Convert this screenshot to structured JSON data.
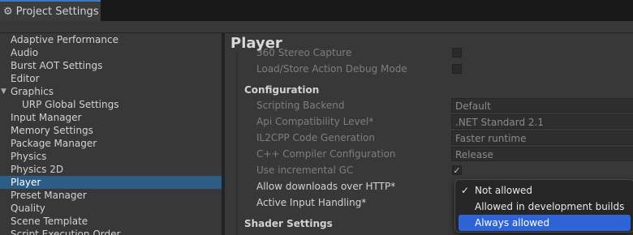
{
  "window": {
    "tab_title": "Project Settings",
    "gear_icon": "gear-icon"
  },
  "sidebar": {
    "items": [
      {
        "label": "Adaptive Performance"
      },
      {
        "label": "Audio"
      },
      {
        "label": "Burst AOT Settings"
      },
      {
        "label": "Editor"
      },
      {
        "label": "Graphics"
      },
      {
        "label": "URP Global Settings"
      },
      {
        "label": "Input Manager"
      },
      {
        "label": "Memory Settings"
      },
      {
        "label": "Package Manager"
      },
      {
        "label": "Physics"
      },
      {
        "label": "Physics 2D"
      },
      {
        "label": "Player"
      },
      {
        "label": "Preset Manager"
      },
      {
        "label": "Quality"
      },
      {
        "label": "Scene Template"
      },
      {
        "label": "Script Execution Order"
      }
    ]
  },
  "main": {
    "title": "Player",
    "rows": {
      "stereo_capture": "360 Stereo Capture",
      "load_store": "Load/Store Action Debug Mode",
      "configuration": "Configuration",
      "scripting_backend": "Scripting Backend",
      "api_compat": "Api Compatibility Level*",
      "il2cpp_gen": "IL2CPP Code Generation",
      "cpp_compiler": "C++ Compiler Configuration",
      "incremental_gc": "Use incremental GC",
      "allow_http": "Allow downloads over HTTP*",
      "active_input": "Active Input Handling*",
      "shader_settings": "Shader Settings"
    },
    "values": {
      "scripting_backend": "Default",
      "api_compat": ".NET Standard 2.1",
      "il2cpp_gen": "Faster runtime",
      "cpp_compiler": "Release",
      "incremental_gc_checked": true
    }
  },
  "dropdown": {
    "options": [
      {
        "label": "Not allowed",
        "checked": true
      },
      {
        "label": "Allowed in development builds",
        "checked": false
      },
      {
        "label": "Always allowed",
        "checked": false
      }
    ],
    "check_glyph": "✓",
    "highlight_color": "#2f64d6"
  }
}
